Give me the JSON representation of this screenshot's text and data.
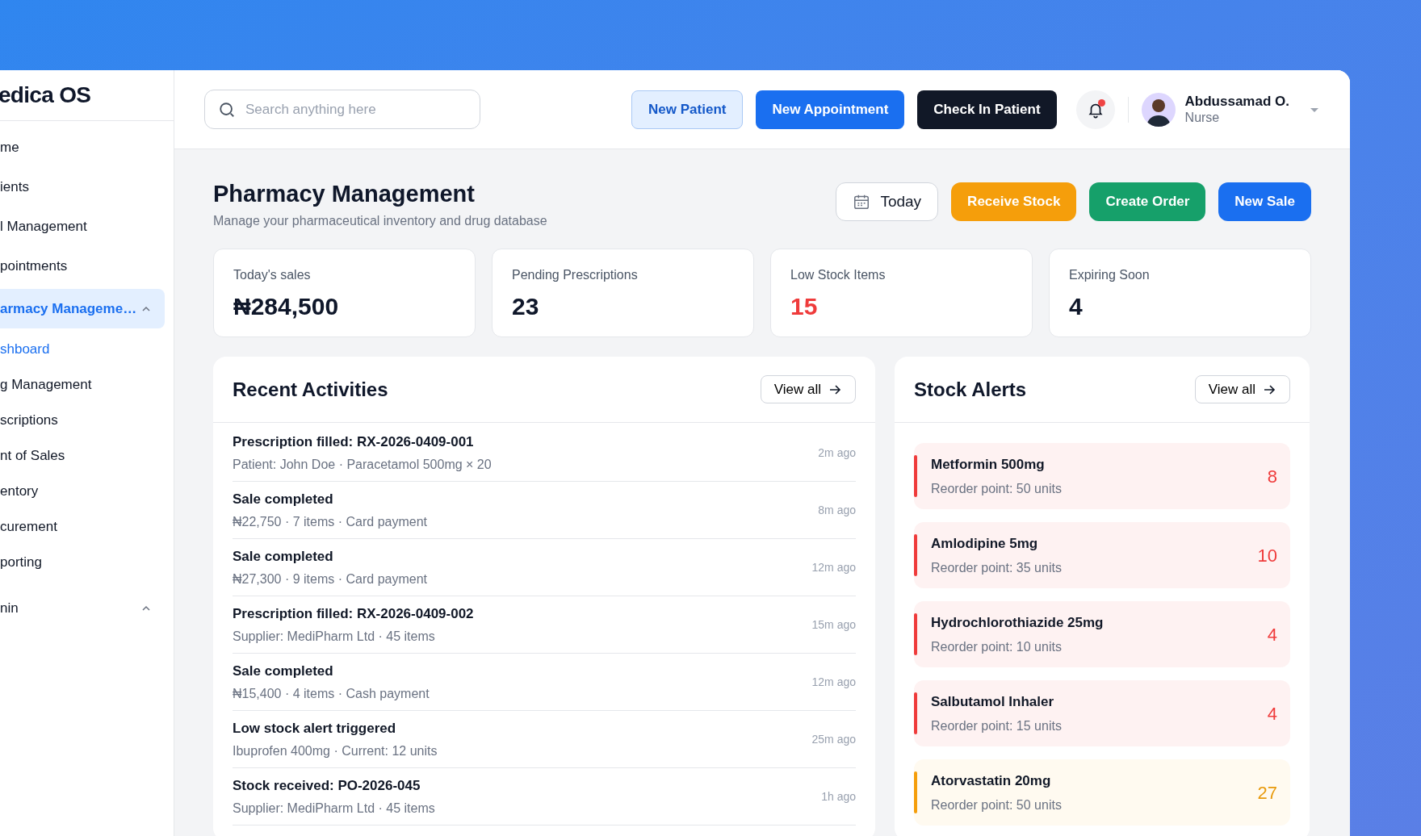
{
  "sidebar": {
    "logo": "edica OS",
    "items": [
      {
        "label": "me",
        "selected": false
      },
      {
        "label": "ients",
        "selected": false
      },
      {
        "label": "l Management",
        "selected": false
      },
      {
        "label": "pointments",
        "selected": false
      },
      {
        "label": "armacy Manageme…",
        "selected": true,
        "expanded": true,
        "children": [
          {
            "label": "shboard",
            "selected": true
          },
          {
            "label": "g Management",
            "selected": false
          },
          {
            "label": "scriptions",
            "selected": false
          },
          {
            "label": "nt of Sales",
            "selected": false
          },
          {
            "label": "entory",
            "selected": false
          },
          {
            "label": "curement",
            "selected": false
          },
          {
            "label": "porting",
            "selected": false
          }
        ]
      },
      {
        "label": "nin",
        "selected": false,
        "expanded": true
      }
    ]
  },
  "header": {
    "search": {
      "placeholder": "Search anything here"
    },
    "buttons": [
      {
        "label": "New Patient",
        "kind": "soft"
      },
      {
        "label": "New Appointment",
        "kind": "primary"
      },
      {
        "label": "Check In Patient",
        "kind": "dark"
      }
    ],
    "notifications": {
      "unread": true
    },
    "user": {
      "name": "Abdussamad O.",
      "role": "Nurse"
    }
  },
  "page": {
    "title": "Pharmacy Management",
    "subtitle": "Manage your pharmaceutical inventory and drug database",
    "date_filter": "Today",
    "actions": [
      {
        "label": "Receive Stock",
        "color": "#f59e0b"
      },
      {
        "label": "Create Order",
        "color": "#16a06a"
      },
      {
        "label": "New Sale",
        "color": "#1a6ff0"
      }
    ]
  },
  "stats": [
    {
      "label": "Today's sales",
      "value": "₦284,500",
      "color": "#0f172a"
    },
    {
      "label": "Pending Prescriptions",
      "value": "23",
      "color": "#0f172a"
    },
    {
      "label": "Low Stock Items",
      "value": "15",
      "color": "#ef3b3b"
    },
    {
      "label": "Expiring Soon",
      "value": "4",
      "color": "#0f172a"
    }
  ],
  "recent_activities": {
    "title": "Recent Activities",
    "view_all": "View all",
    "items": [
      {
        "title": "Prescription filled: RX-2026-0409-001",
        "detail": "Patient: John Doe · Paracetamol 500mg × 20",
        "time": "2m ago"
      },
      {
        "title": "Sale completed",
        "detail": "₦22,750 · 7 items · Card payment",
        "time": "8m ago"
      },
      {
        "title": "Sale completed",
        "detail": "₦27,300 · 9 items · Card payment",
        "time": "12m ago"
      },
      {
        "title": "Prescription filled: RX-2026-0409-002",
        "detail": "Supplier: MediPharm Ltd · 45 items",
        "time": "15m ago"
      },
      {
        "title": "Sale completed",
        "detail": "₦15,400 · 4 items · Cash payment",
        "time": "12m ago"
      },
      {
        "title": "Low stock alert triggered",
        "detail": "Ibuprofen 400mg · Current: 12 units",
        "time": "25m ago"
      },
      {
        "title": "Stock received: PO-2026-045",
        "detail": "Supplier: MediPharm Ltd · 45 items",
        "time": "1h ago"
      }
    ]
  },
  "stock_alerts": {
    "title": "Stock Alerts",
    "view_all": "View all",
    "items": [
      {
        "name": "Metformin 500mg",
        "reorder": "Reorder point: 50 units",
        "count": "8",
        "kind": "critical"
      },
      {
        "name": "Amlodipine 5mg",
        "reorder": "Reorder point: 35 units",
        "count": "10",
        "kind": "critical"
      },
      {
        "name": "Hydrochlorothiazide 25mg",
        "reorder": "Reorder point: 10 units",
        "count": "4",
        "kind": "critical"
      },
      {
        "name": "Salbutamol Inhaler",
        "reorder": "Reorder point: 15 units",
        "count": "4",
        "kind": "critical"
      },
      {
        "name": "Atorvastatin 20mg",
        "reorder": "Reorder point: 50 units",
        "count": "27",
        "kind": "warning"
      }
    ]
  }
}
